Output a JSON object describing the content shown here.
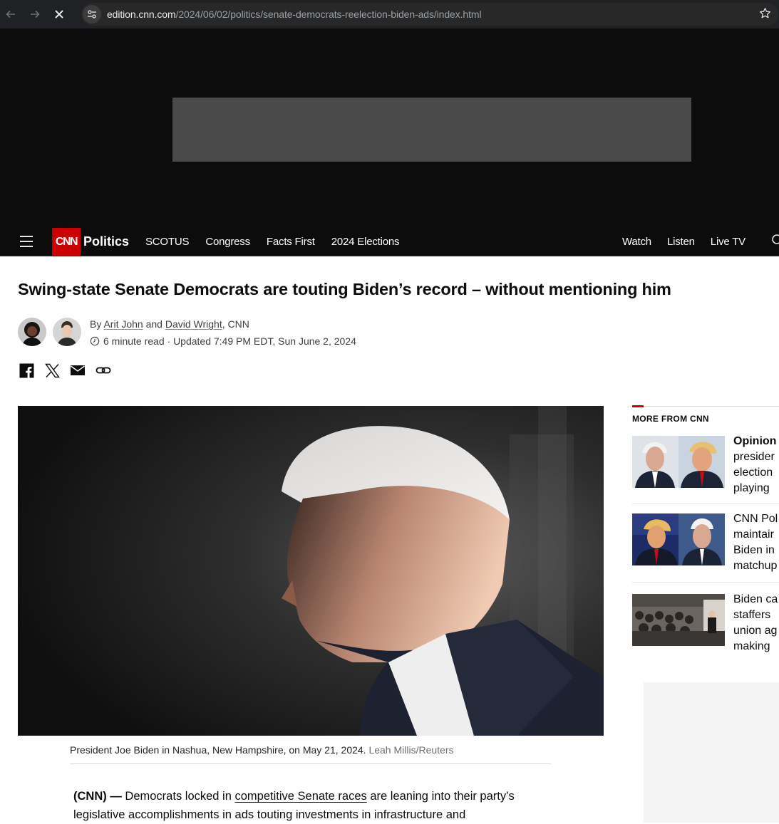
{
  "browser": {
    "url_host": "edition.cnn.com",
    "url_path": "/2024/06/02/politics/senate-democrats-reelection-biden-ads/index.html"
  },
  "nav": {
    "logo": "CNN",
    "section": "Politics",
    "links": [
      "SCOTUS",
      "Congress",
      "Facts First",
      "2024 Elections"
    ],
    "right_links": [
      "Watch",
      "Listen",
      "Live TV"
    ]
  },
  "article": {
    "headline": "Swing-state Senate Democrats are touting Biden’s record – without mentioning him",
    "byline_prefix": "By ",
    "author1": "Arit John",
    "byline_and": " and ",
    "author2": "David Wright",
    "byline_suffix": ", CNN",
    "read_time": "6 minute read",
    "separator": " · ",
    "updated": "Updated 7:49 PM EDT, Sun June 2, 2024",
    "caption": "President Joe Biden in Nashua, New Hampshire, on May 21, 2024. ",
    "credit": "Leah Millis/Reuters",
    "dateline": "(CNN)",
    "dash": " — ",
    "body_pre": "Democrats locked in ",
    "body_link": "competitive Senate races",
    "body_post": " are leaning into their party’s legislative accomplishments in ads touting investments in infrastructure and"
  },
  "sidebar": {
    "title": "MORE FROM CNN",
    "items": [
      {
        "lines": [
          "Opinion",
          "presider",
          "election",
          "playing"
        ]
      },
      {
        "lines": [
          "CNN Pol",
          "maintair",
          "Biden in",
          "matchup"
        ]
      },
      {
        "lines": [
          "Biden ca",
          "staffers",
          "union ag",
          "making"
        ]
      }
    ]
  },
  "icons": {
    "back": "arrow-left-icon",
    "forward": "arrow-right-icon",
    "stop": "close-icon",
    "site_info": "tune-icon",
    "bookmark": "star-icon",
    "menu": "hamburger-icon",
    "search": "search-icon",
    "share": [
      "facebook-icon",
      "x-icon",
      "email-icon",
      "link-icon"
    ]
  },
  "colors": {
    "cnn_red": "#cc0000",
    "nav_bg": "#0c0c0c",
    "text": "#0c0c0c"
  }
}
